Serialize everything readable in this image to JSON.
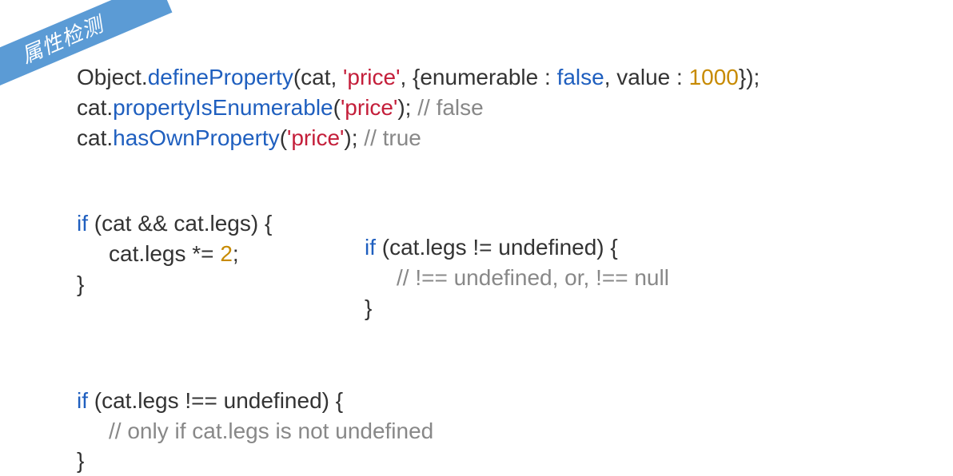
{
  "ribbon": "属性检测",
  "block1": {
    "l1": {
      "p1": "Object.",
      "m1": "defineProperty",
      "p2": "(cat, ",
      "s1": "'price'",
      "p3": ", {enumerable : ",
      "kw1": "false",
      "p4": ", value : ",
      "n1": "1000",
      "p5": "});"
    },
    "l2": {
      "p1": "cat.",
      "m1": "propertyIsEnumerable",
      "p2": "(",
      "s1": "'price'",
      "p3": "); ",
      "c1": "// false"
    },
    "l3": {
      "p1": "cat.",
      "m1": "hasOwnProperty",
      "p2": "(",
      "s1": "'price'",
      "p3": "); ",
      "c1": "// true"
    }
  },
  "block2L": {
    "l1": {
      "kw1": "if",
      "p1": " (cat && cat.legs) {"
    },
    "l2": {
      "p1": "cat.legs *= ",
      "n1": "2",
      "p2": ";"
    },
    "l3": "}"
  },
  "block2R": {
    "l1": {
      "kw1": "if",
      "p1": " (cat.legs != undefined) {"
    },
    "l2": "// !== undefined, or, !== null",
    "l3": "}"
  },
  "block3": {
    "l1": {
      "kw1": "if",
      "p1": " (cat.legs !== undefined) {"
    },
    "l2": "// only if cat.legs is not undefined",
    "l3": "}"
  }
}
